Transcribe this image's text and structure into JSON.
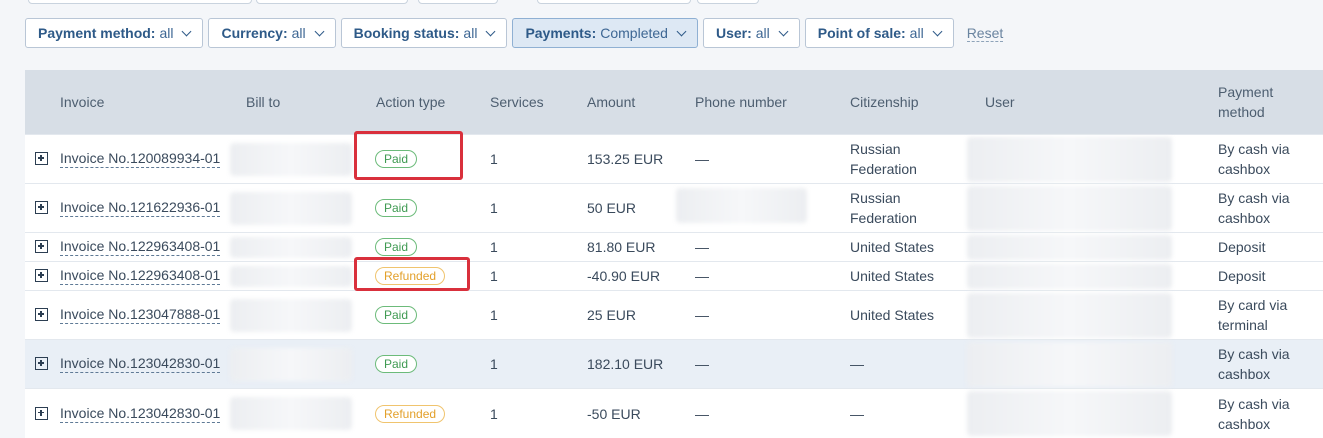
{
  "filters": [
    {
      "name": "Payment method:",
      "value": "all",
      "active": false
    },
    {
      "name": "Currency:",
      "value": "all",
      "active": false
    },
    {
      "name": "Booking status:",
      "value": "all",
      "active": false
    },
    {
      "name": "Payments:",
      "value": "Completed",
      "active": true
    },
    {
      "name": "User:",
      "value": "all",
      "active": false
    },
    {
      "name": "Point of sale:",
      "value": "all",
      "active": false
    }
  ],
  "reset_label": "Reset",
  "columns": {
    "invoice": "Invoice",
    "bill_to": "Bill to",
    "action_type": "Action type",
    "services": "Services",
    "amount": "Amount",
    "phone": "Phone number",
    "citizenship": "Citizenship",
    "user": "User",
    "payment_method_1": "Payment",
    "payment_method_2": "method"
  },
  "rows": [
    {
      "invoice": "Invoice No.120089934-01",
      "action": "Paid",
      "services": "1",
      "amount": "153.25 EUR",
      "phone": "—",
      "citizenship_1": "Russian",
      "citizenship_2": "Federation",
      "pm_1": "By cash via",
      "pm_2": "cashbox"
    },
    {
      "invoice": "Invoice No.121622936-01",
      "action": "Paid",
      "services": "1",
      "amount": "50 EUR",
      "phone": "",
      "citizenship_1": "Russian",
      "citizenship_2": "Federation",
      "pm_1": "By cash via",
      "pm_2": "cashbox"
    },
    {
      "invoice": "Invoice No.122963408-01",
      "action": "Paid",
      "services": "1",
      "amount": "81.80 EUR",
      "phone": "—",
      "citizenship_1": "United States",
      "citizenship_2": "",
      "pm_1": "Deposit",
      "pm_2": ""
    },
    {
      "invoice": "Invoice No.122963408-01",
      "action": "Refunded",
      "services": "1",
      "amount": "-40.90 EUR",
      "phone": "—",
      "citizenship_1": "United States",
      "citizenship_2": "",
      "pm_1": "Deposit",
      "pm_2": ""
    },
    {
      "invoice": "Invoice No.123047888-01",
      "action": "Paid",
      "services": "1",
      "amount": "25 EUR",
      "phone": "—",
      "citizenship_1": "United States",
      "citizenship_2": "",
      "pm_1": "By card via",
      "pm_2": "terminal"
    },
    {
      "invoice": "Invoice No.123042830-01",
      "action": "Paid",
      "services": "1",
      "amount": "182.10 EUR",
      "phone": "—",
      "citizenship_1": "—",
      "citizenship_2": "",
      "pm_1": "By cash via",
      "pm_2": "cashbox"
    },
    {
      "invoice": "Invoice No.123042830-01",
      "action": "Refunded",
      "services": "1",
      "amount": "-50 EUR",
      "phone": "—",
      "citizenship_1": "—",
      "citizenship_2": "",
      "pm_1": "By cash via",
      "pm_2": "cashbox"
    }
  ]
}
